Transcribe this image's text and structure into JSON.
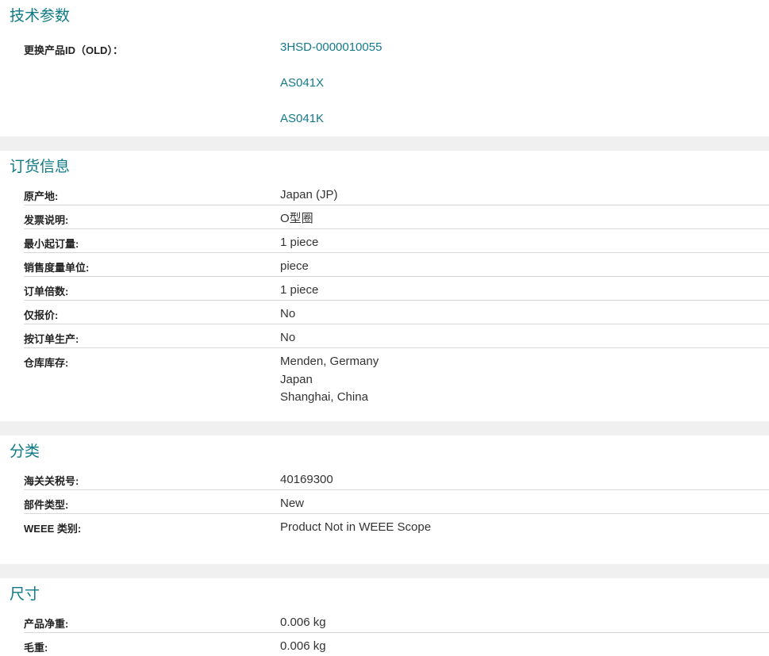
{
  "tech": {
    "title": "技术参数",
    "replace_label": "更换产品ID（OLD）：",
    "replace_ids": [
      "3HSD-0000010055",
      "AS041X",
      "AS041K"
    ]
  },
  "order": {
    "title": "订货信息",
    "rows": [
      {
        "label": "原产地:",
        "value": "Japan (JP)"
      },
      {
        "label": "发票说明:",
        "value": "O型圈"
      },
      {
        "label": "最小起订量:",
        "value": "1 piece"
      },
      {
        "label": "销售度量单位:",
        "value": "piece"
      },
      {
        "label": "订单倍数:",
        "value": "1 piece"
      },
      {
        "label": "仅报价:",
        "value": "No"
      },
      {
        "label": "按订单生产:",
        "value": "No"
      }
    ],
    "stock_label": "仓库库存:",
    "stock_values": [
      "Menden, Germany",
      "Japan",
      "Shanghai, China"
    ]
  },
  "classification": {
    "title": "分类",
    "rows": [
      {
        "label": "海关关税号:",
        "value": "40169300"
      },
      {
        "label": "部件类型:",
        "value": "New"
      },
      {
        "label": "WEEE 类别:",
        "value": "Product Not in WEEE Scope"
      }
    ]
  },
  "dimensions": {
    "title": "尺寸",
    "rows": [
      {
        "label": "产品净重:",
        "value": "0.006 kg"
      },
      {
        "label": "毛重:",
        "value": "0.006 kg"
      }
    ]
  },
  "colors": {
    "accent": "#0e7a84",
    "separator": "#f0f0f0"
  }
}
